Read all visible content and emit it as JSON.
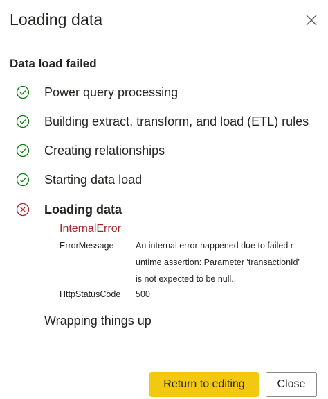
{
  "dialog": {
    "title": "Loading data",
    "close_icon": "close-icon",
    "subtitle": "Data load failed"
  },
  "steps": [
    {
      "label": "Power query processing",
      "status": "success",
      "icon": "check-circle-icon"
    },
    {
      "label": "Building extract, transform, and load (ETL) rules",
      "status": "success",
      "icon": "check-circle-icon"
    },
    {
      "label": "Creating relationships",
      "status": "success",
      "icon": "check-circle-icon"
    },
    {
      "label": "Starting data load",
      "status": "success",
      "icon": "check-circle-icon"
    },
    {
      "label": "Loading data",
      "status": "error",
      "icon": "error-circle-icon"
    }
  ],
  "error": {
    "title": "InternalError",
    "error_message_key": "ErrorMessage",
    "error_message_lines": [
      "An internal error happened due to failed r",
      "untime assertion: Parameter 'transactionId'",
      "is not expected to be null.."
    ],
    "status_code_key": "HttpStatusCode",
    "status_code_value": "500"
  },
  "pending_step": {
    "label": "Wrapping things up"
  },
  "buttons": {
    "primary_label": "Return to editing",
    "secondary_label": "Close"
  },
  "colors": {
    "success": "#107c10",
    "error": "#a4262c",
    "primary_button": "#f2c811",
    "text": "#252423"
  }
}
